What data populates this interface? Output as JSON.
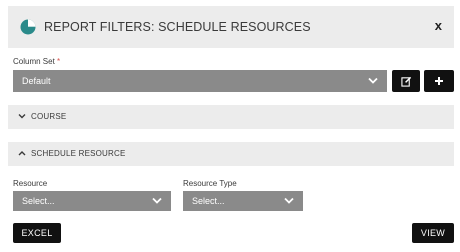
{
  "dialog": {
    "title": "REPORT FILTERS: SCHEDULE RESOURCES",
    "close_label": "x"
  },
  "column_set": {
    "label": "Column Set",
    "required_marker": "*",
    "value": "Default"
  },
  "sections": {
    "course": {
      "label": "COURSE",
      "state": "collapsed"
    },
    "schedule_resource": {
      "label": "SCHEDULE RESOURCE",
      "state": "expanded"
    }
  },
  "filters": {
    "resource": {
      "label": "Resource",
      "value": "Select..."
    },
    "resource_type": {
      "label": "Resource Type",
      "value": "Select..."
    }
  },
  "actions": {
    "excel_label": "EXCEL",
    "view_label": "VIEW"
  },
  "colors": {
    "header_bg": "#ececec",
    "brand_icon": "#2a8a8a",
    "select_bg": "#8a8a8a",
    "button_bg": "#111111",
    "required": "#d9534f"
  },
  "icons": {
    "header": "pie-chart-icon",
    "close": "close-icon",
    "edit": "edit-icon",
    "add": "plus-icon",
    "dropdown": "chevron-down-icon",
    "collapsed_section": "chevron-down-icon",
    "expanded_section": "chevron-up-icon"
  }
}
